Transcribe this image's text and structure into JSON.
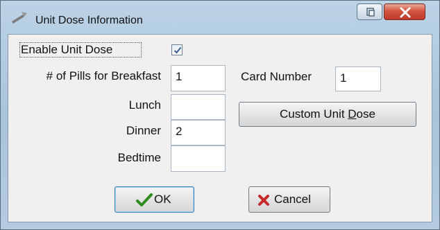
{
  "window": {
    "title": "Unit Dose Information"
  },
  "form": {
    "enable_label": "Enable Unit Dose",
    "enable_checked": true,
    "breakfast_label": "# of Pills for Breakfast",
    "breakfast_value": "1",
    "lunch_label": "Lunch",
    "lunch_value": "",
    "dinner_label": "Dinner",
    "dinner_value": "2",
    "bedtime_label": "Bedtime",
    "bedtime_value": "",
    "card_number_label": "Card Number",
    "card_number_value": "1"
  },
  "buttons": {
    "custom_pre": "Custom Unit ",
    "custom_mnemonic": "D",
    "custom_post": "ose",
    "ok": "OK",
    "cancel": "Cancel"
  },
  "icons": {
    "title": "pill-dispenser-icon",
    "restore": "restore-icon",
    "close": "close-icon",
    "checkmark": "checkmark-icon",
    "cancel": "x-icon"
  },
  "colors": {
    "close_button": "#c0392b",
    "ok_check": "#2e8b1e",
    "cancel_x": "#c62828"
  }
}
